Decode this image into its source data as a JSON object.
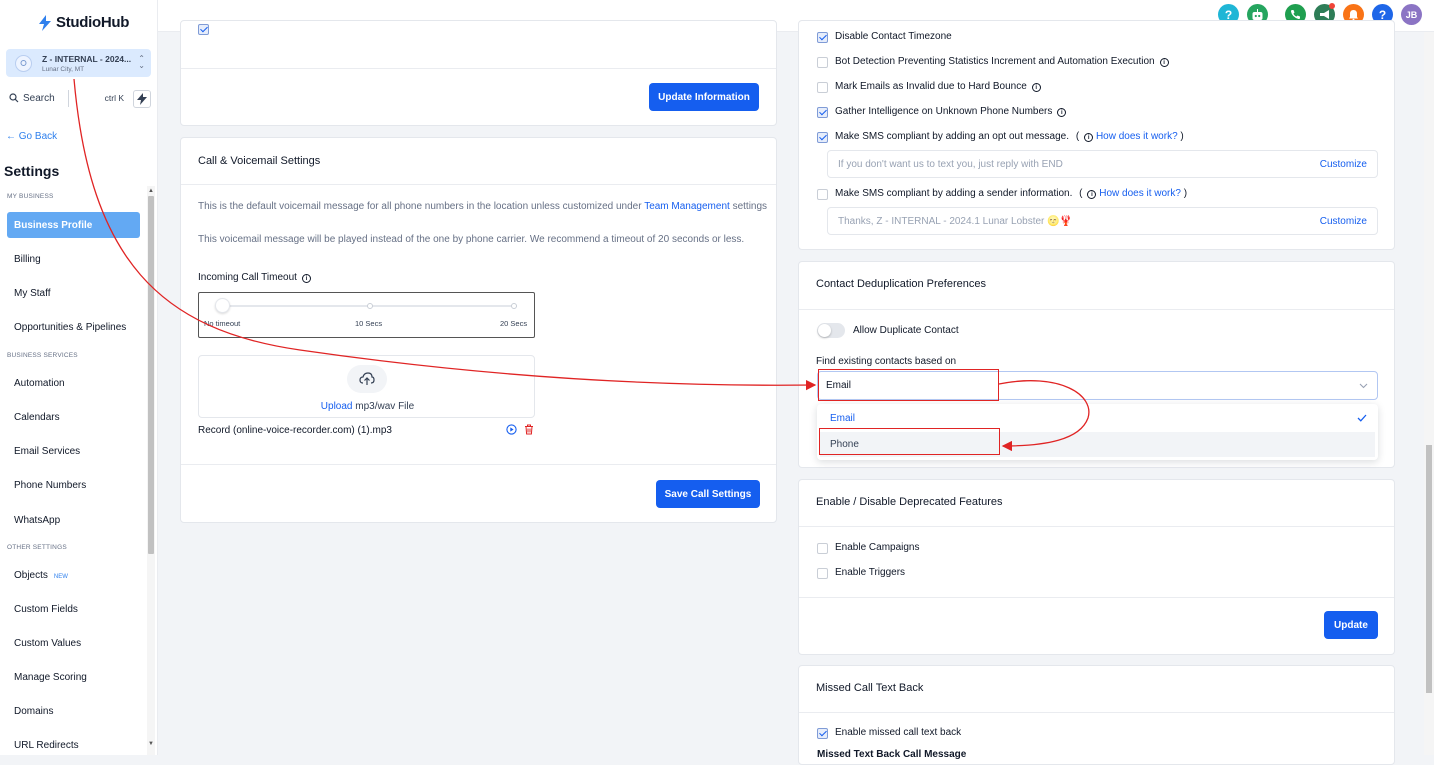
{
  "app": {
    "name": "StudioHub"
  },
  "location": {
    "name": "Z - INTERNAL - 2024...",
    "city": "Lunar City, MT"
  },
  "search": {
    "label": "Search",
    "shortcut": "ctrl K"
  },
  "nav": {
    "go_back": "← Go Back",
    "title": "Settings",
    "sections": {
      "my_business": "MY BUSINESS",
      "business_services": "BUSINESS SERVICES",
      "other_settings": "OTHER SETTINGS"
    },
    "items": {
      "business_profile": "Business Profile",
      "billing": "Billing",
      "my_staff": "My Staff",
      "opportunities": "Opportunities & Pipelines",
      "automation": "Automation",
      "calendars": "Calendars",
      "email_services": "Email Services",
      "phone_numbers": "Phone Numbers",
      "whatsapp": "WhatsApp",
      "objects": "Objects",
      "objects_badge": "NEW",
      "custom_fields": "Custom Fields",
      "custom_values": "Custom Values",
      "manage_scoring": "Manage Scoring",
      "domains": "Domains",
      "url_redirects": "URL Redirects"
    }
  },
  "topbar": {
    "avatar": "JB",
    "help": "?"
  },
  "business_info": {
    "update_button": "Update Information"
  },
  "call_settings": {
    "title": "Call & Voicemail Settings",
    "desc1_prefix": "This is the default voicemail message for all phone numbers in the location unless customized under",
    "desc1_link": "Team Management",
    "desc1_suffix": "settings",
    "desc2": "This voicemail message will be played instead of the one by phone carrier. We recommend a timeout of 20 seconds or less.",
    "timeout_label": "Incoming Call Timeout",
    "slider_labels": [
      "No timeout",
      "10 Secs",
      "20 Secs"
    ],
    "slider_value": 0,
    "upload_link": "Upload",
    "upload_text": " mp3/wav File",
    "recording_file": "Record (online-voice-recorder.com) (1).mp3",
    "save_button": "Save Call Settings"
  },
  "contact_settings": {
    "options": [
      {
        "label": "Disable Contact Timezone",
        "checked": true,
        "info": false
      },
      {
        "label": "Bot Detection Preventing Statistics Increment and Automation Execution",
        "checked": false,
        "info": true
      },
      {
        "label": "Mark Emails as Invalid due to Hard Bounce",
        "checked": false,
        "info": true
      },
      {
        "label": "Gather Intelligence on Unknown Phone Numbers",
        "checked": true,
        "info": true
      }
    ],
    "sms_optout": {
      "label": "Make SMS compliant by adding an opt out message.",
      "checked": true,
      "paren_open": "(",
      "how": "How does it work?",
      "paren_close": ")",
      "placeholder": "If you don't want us to text you, just reply with END",
      "customize": "Customize"
    },
    "sms_sender": {
      "label": "Make SMS compliant by adding a sender information.",
      "checked": false,
      "paren_open": "(",
      "how": "How does it work?",
      "paren_close": ")",
      "placeholder": "Thanks, Z - INTERNAL - 2024.1 Lunar Lobster 🌝🦞",
      "customize": "Customize"
    }
  },
  "dedup": {
    "title": "Contact Deduplication Preferences",
    "allow_duplicate": "Allow Duplicate Contact",
    "allow_duplicate_on": false,
    "find_label": "Find existing contacts based on",
    "selected": "Email",
    "options": [
      "Email",
      "Phone"
    ]
  },
  "deprecated": {
    "title": "Enable / Disable Deprecated Features",
    "options": [
      {
        "label": "Enable Campaigns",
        "checked": false
      },
      {
        "label": "Enable Triggers",
        "checked": false
      }
    ],
    "update_button": "Update"
  },
  "missed_call": {
    "title": "Missed Call Text Back",
    "enable_label": "Enable missed call text back",
    "enable_checked": true,
    "message_label": "Missed Text Back Call Message"
  },
  "colors": {
    "primary": "#155eef",
    "active_nav": "#63a9f3",
    "annotation": "#e02424"
  }
}
